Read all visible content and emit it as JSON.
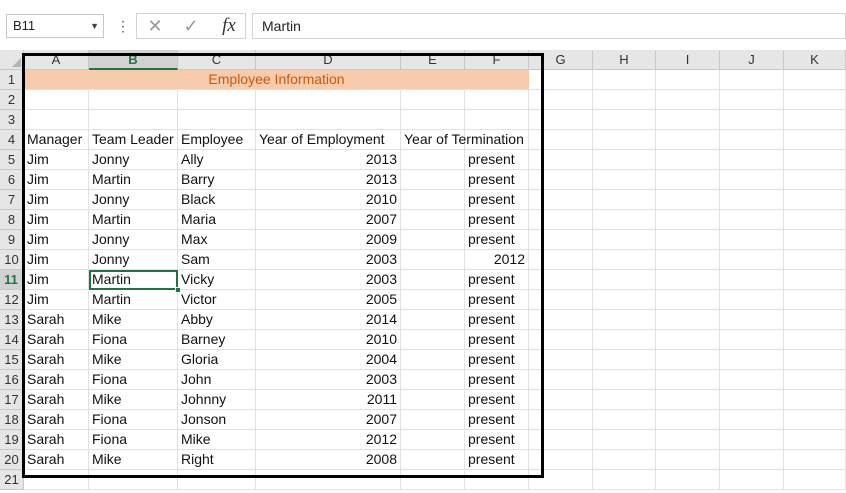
{
  "formula_bar": {
    "name_box": "B11",
    "formula_value": "Martin",
    "icons": [
      "cancel-icon",
      "enter-icon",
      "fx-icon"
    ],
    "fx_label": "fx"
  },
  "sheet": {
    "columns": [
      "A",
      "B",
      "C",
      "D",
      "E",
      "F",
      "G",
      "H",
      "I",
      "J",
      "K"
    ],
    "rows": [
      "1",
      "2",
      "3",
      "4",
      "5",
      "6",
      "7",
      "8",
      "9",
      "10",
      "11",
      "12",
      "13",
      "14",
      "15",
      "16",
      "17",
      "18",
      "19",
      "20",
      "21"
    ],
    "active_cell": "B11",
    "title": "Employee Information",
    "headers": [
      "Manager",
      "Team Leader",
      "Employee",
      "Year of Employment",
      "Year of Termination"
    ],
    "records": [
      [
        "Jim",
        "Jonny",
        "Ally",
        "2013",
        "present"
      ],
      [
        "Jim",
        "Martin",
        "Barry",
        "2013",
        "present"
      ],
      [
        "Jim",
        "Jonny",
        "Black",
        "2010",
        "present"
      ],
      [
        "Jim",
        "Martin",
        "Maria",
        "2007",
        "present"
      ],
      [
        "Jim",
        "Jonny",
        "Max",
        "2009",
        "present"
      ],
      [
        "Jim",
        "Jonny",
        "Sam",
        "2003",
        "2012"
      ],
      [
        "Jim",
        "Martin",
        "Vicky",
        "2003",
        "present"
      ],
      [
        "Jim",
        "Martin",
        "Victor",
        "2005",
        "present"
      ],
      [
        "Sarah",
        "Mike",
        "Abby",
        "2014",
        "present"
      ],
      [
        "Sarah",
        "Fiona",
        "Barney",
        "2010",
        "present"
      ],
      [
        "Sarah",
        "Mike",
        "Gloria",
        "2004",
        "present"
      ],
      [
        "Sarah",
        "Fiona",
        "John",
        "2003",
        "present"
      ],
      [
        "Sarah",
        "Mike",
        "Johnny",
        "2011",
        "present"
      ],
      [
        "Sarah",
        "Fiona",
        "Jonson",
        "2007",
        "present"
      ],
      [
        "Sarah",
        "Fiona",
        "Mike",
        "2012",
        "present"
      ],
      [
        "Sarah",
        "Mike",
        "Right",
        "2008",
        "present"
      ]
    ],
    "colors": {
      "title_fill": "#f8cbad",
      "title_text": "#c55a11",
      "selection": "#217346",
      "outline": "#000000"
    }
  }
}
